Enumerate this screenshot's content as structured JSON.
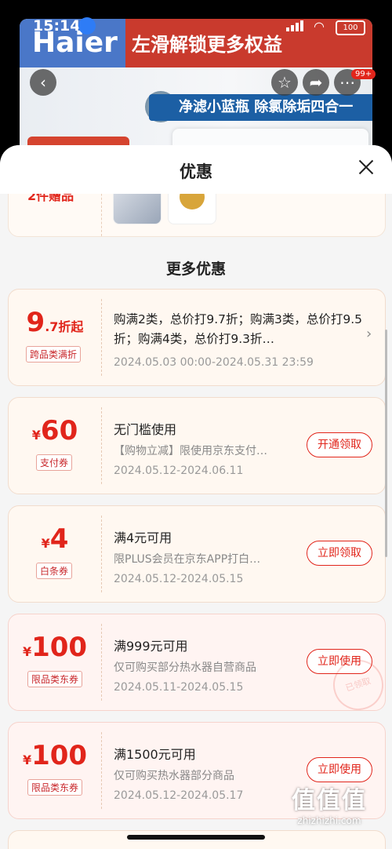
{
  "status_bar": {
    "time": "15:14",
    "battery": "100"
  },
  "product_banner": {
    "brand": "Haier",
    "promo_text": "左滑解锁更多权益",
    "tagline": "净滤小蓝瓶 除氯除垢四合一",
    "notification_badge": "99+"
  },
  "sheet": {
    "title": "优惠",
    "gift": {
      "label": "2件赠品"
    },
    "more_section_title": "更多优惠"
  },
  "coupons": [
    {
      "amount_big": "9",
      "amount_small": ".7折起",
      "type": "跨品类满折",
      "title": "购满2类，总价打9.7折；购满3类，总价打9.5折；购满4类，总价打9.3折…",
      "date": "2024.05.03 00:00-2024.05.31 23:59"
    },
    {
      "symbol": "¥",
      "amount": "60",
      "type": "支付券",
      "title": "无门槛使用",
      "desc": "【购物立减】限使用京东支付…",
      "date": "2024.05.12-2024.06.11",
      "button": "开通领取"
    },
    {
      "symbol": "¥",
      "amount": "4",
      "type": "白条券",
      "title": "满4元可用",
      "desc": "限PLUS会员在京东APP打白…",
      "date": "2024.05.12-2024.05.15",
      "button": "立即领取"
    },
    {
      "symbol": "¥",
      "amount": "100",
      "type": "限品类东券",
      "title": "满999元可用",
      "desc": "仅可购买部分热水器自营商品",
      "date": "2024.05.11-2024.05.15",
      "button": "立即使用",
      "stamp": "已领取"
    },
    {
      "symbol": "¥",
      "amount": "100",
      "type": "限品类东券",
      "title": "满1500元可用",
      "desc": "仅可购买热水器部分商品",
      "date": "2024.05.12-2024.05.17",
      "button": "立即使用"
    }
  ],
  "watermark": {
    "big": "值值值",
    "site": "zhizhizhi.com"
  },
  "colors": {
    "accent": "#e1251b",
    "card_bg": "#fff8f1",
    "sheet_bg": "#f5f5f5"
  }
}
